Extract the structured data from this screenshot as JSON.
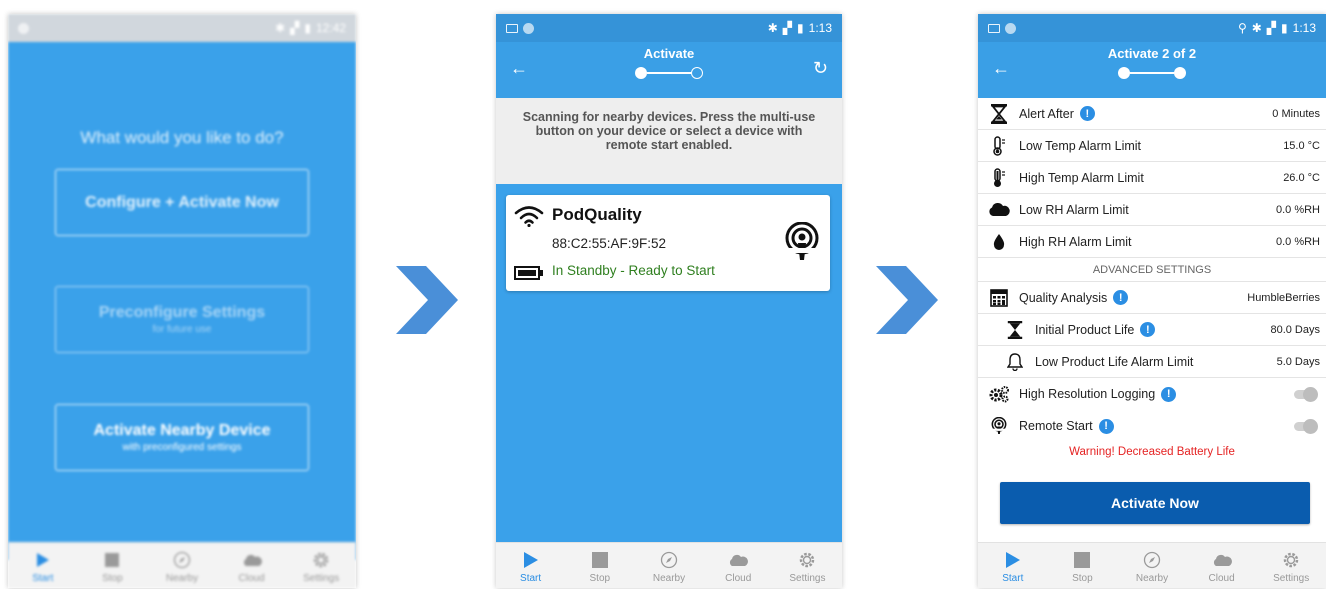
{
  "screen1": {
    "status_time": "12:42",
    "question": "What would you like to do?",
    "buttons": [
      {
        "label": "Configure + Activate Now",
        "sub": ""
      },
      {
        "label": "Preconfigure Settings",
        "sub": "for future use"
      },
      {
        "label": "Activate Nearby Device",
        "sub": "with preconfigured settings"
      }
    ]
  },
  "screen2": {
    "status_time": "1:13",
    "title": "Activate",
    "scan_message": "Scanning for nearby devices. Press the multi-use button on your device or select a device with remote start enabled.",
    "device": {
      "name": "PodQuality",
      "mac": "88:C2:55:AF:9F:52",
      "status": "In Standby - Ready to Start"
    }
  },
  "screen3": {
    "status_time": "1:13",
    "title": "Activate 2 of 2",
    "settings": [
      {
        "label": "Alert After",
        "value": "0 Minutes",
        "icon": "hourglass-icon"
      },
      {
        "label": "Low Temp Alarm Limit",
        "value": "15.0 °C",
        "icon": "thermometer-low-icon"
      },
      {
        "label": "High Temp Alarm Limit",
        "value": "26.0 °C",
        "icon": "thermometer-high-icon"
      },
      {
        "label": "Low RH Alarm Limit",
        "value": "0.0 %RH",
        "icon": "cloud-icon"
      },
      {
        "label": "High RH Alarm Limit",
        "value": "0.0 %RH",
        "icon": "drop-icon"
      }
    ],
    "advanced_header": "ADVANCED SETTINGS",
    "advanced": [
      {
        "label": "Quality Analysis",
        "value": "HumbleBerries",
        "icon": "calculator-icon"
      },
      {
        "label": "Initial Product Life",
        "value": "80.0 Days",
        "icon": "hourglass-icon"
      },
      {
        "label": "Low Product Life Alarm Limit",
        "value": "5.0 Days",
        "icon": "bell-icon"
      },
      {
        "label": "High Resolution Logging",
        "icon": "gears-icon"
      },
      {
        "label": "Remote Start",
        "icon": "podcast-icon"
      }
    ],
    "warning": "Warning! Decreased Battery Life",
    "activate_button": "Activate Now"
  },
  "nav": [
    "Start",
    "Stop",
    "Nearby",
    "Cloud",
    "Settings"
  ],
  "colors": {
    "primary": "#3aa1ea",
    "header": "#3a9fe6",
    "dark_button": "#0a5cae",
    "warning": "#e52222",
    "ok_green": "#2f7f1f",
    "chevron": "#4a8fd8"
  }
}
